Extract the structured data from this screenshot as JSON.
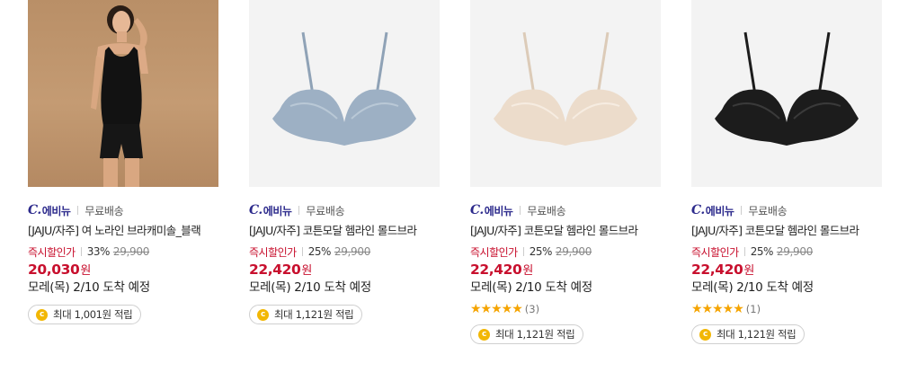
{
  "products": [
    {
      "image_icon": "model-camisole-image",
      "seller_logo": "C.",
      "seller_name": "에비뉴",
      "shipping": "무료배송",
      "title": "[JAJU/자주] 여 노라인 브라캐미솔_블랙",
      "discount_label": "즉시할인가",
      "discount_rate": "33%",
      "original_price": "29,900",
      "price": "20,030",
      "currency": "원",
      "arrival": "모레(목) 2/10 도착 예정",
      "rating": null,
      "reward": "최대 1,001원 적립",
      "coin": "c"
    },
    {
      "image_icon": "blue-bra-image",
      "seller_logo": "C.",
      "seller_name": "에비뉴",
      "shipping": "무료배송",
      "title": "[JAJU/자주] 코튼모달 헴라인 몰드브라",
      "discount_label": "즉시할인가",
      "discount_rate": "25%",
      "original_price": "29,900",
      "price": "22,420",
      "currency": "원",
      "arrival": "모레(목) 2/10 도착 예정",
      "rating": null,
      "reward": "최대 1,121원 적립",
      "coin": "c"
    },
    {
      "image_icon": "beige-bra-image",
      "seller_logo": "C.",
      "seller_name": "에비뉴",
      "shipping": "무료배송",
      "title": "[JAJU/자주] 코튼모달 헴라인 몰드브라",
      "discount_label": "즉시할인가",
      "discount_rate": "25%",
      "original_price": "29,900",
      "price": "22,420",
      "currency": "원",
      "arrival": "모레(목) 2/10 도착 예정",
      "rating": {
        "stars": "★★★★★",
        "score": 4.5,
        "count": "(3)"
      },
      "reward": "최대 1,121원 적립",
      "coin": "c"
    },
    {
      "image_icon": "black-bra-image",
      "seller_logo": "C.",
      "seller_name": "에비뉴",
      "shipping": "무료배송",
      "title": "[JAJU/자주] 코튼모달 헴라인 몰드브라",
      "discount_label": "즉시할인가",
      "discount_rate": "25%",
      "original_price": "29,900",
      "price": "22,420",
      "currency": "원",
      "arrival": "모레(목) 2/10 도착 예정",
      "rating": {
        "stars": "★★★★★",
        "score": 5,
        "count": "(1)"
      },
      "reward": "최대 1,121원 적립",
      "coin": "c"
    }
  ],
  "colors": {
    "accent_red": "#c8102e",
    "seller_navy": "#2c2a8c",
    "star_gold": "#f5a400",
    "coin_gold": "#f2b705",
    "bra_blue": "#9db0c4",
    "bra_beige": "#ecdccb",
    "bra_black": "#1c1c1c"
  }
}
